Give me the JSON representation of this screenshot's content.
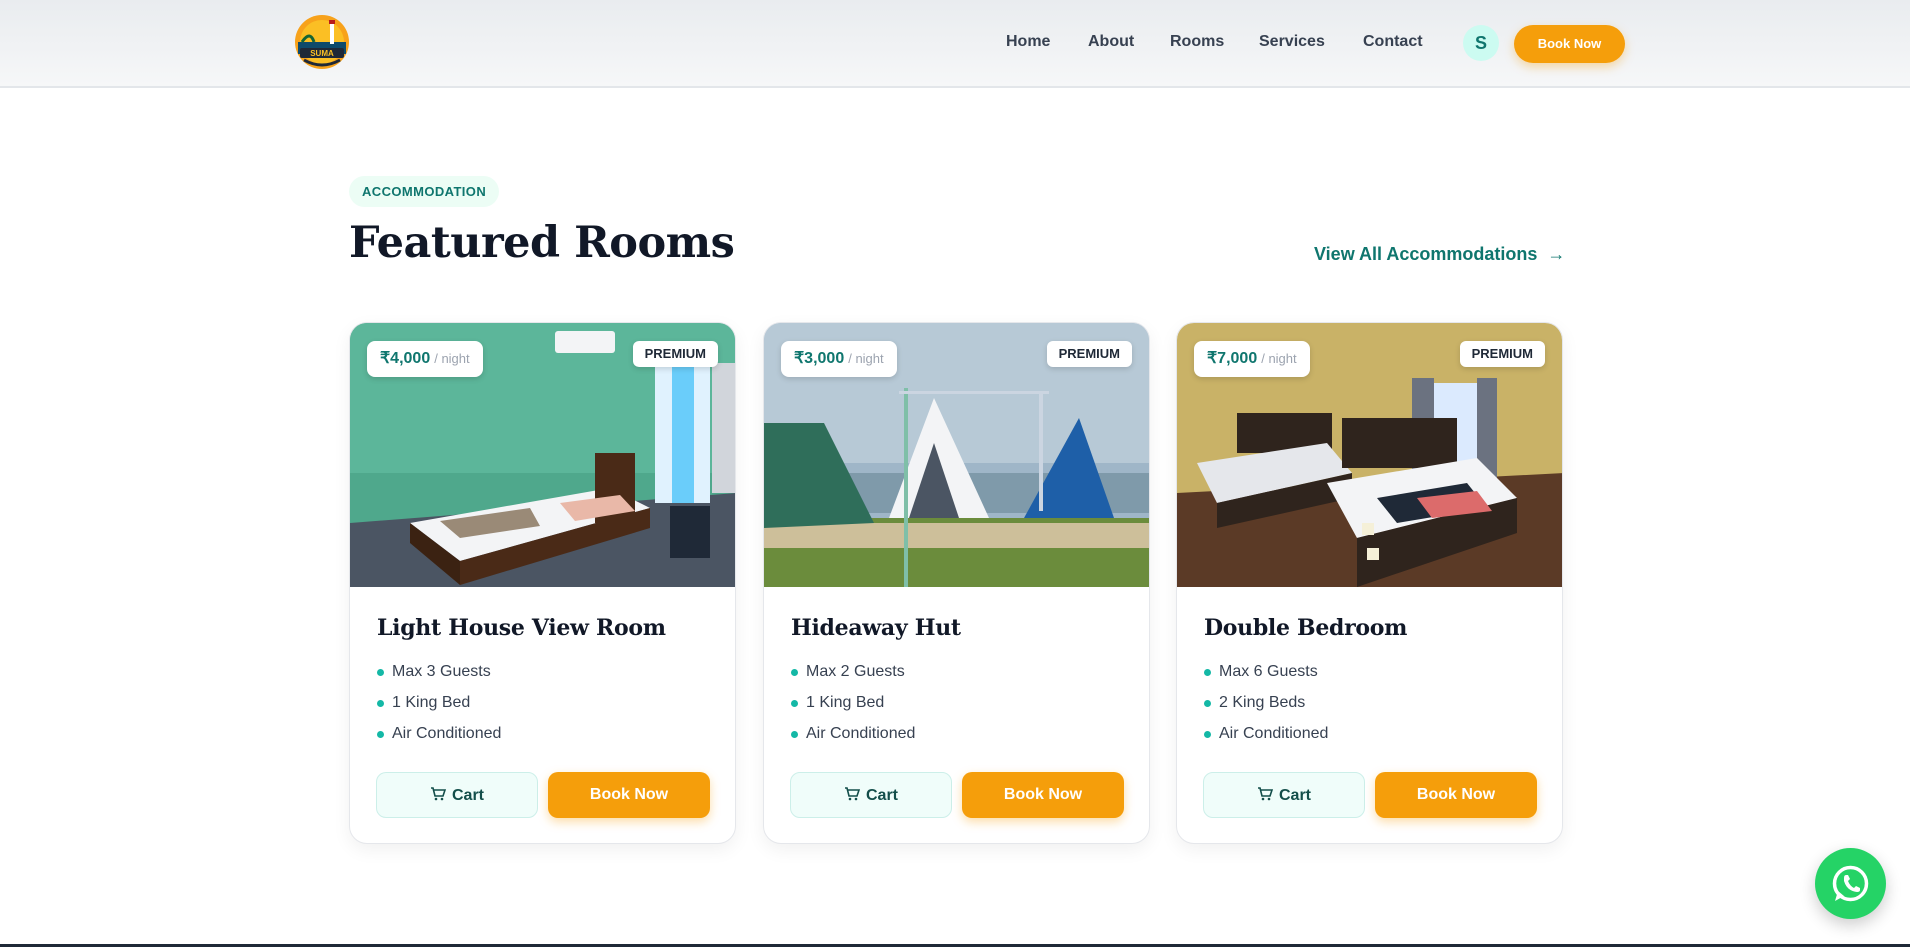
{
  "header": {
    "logo_text": "SUMA",
    "nav": [
      "Home",
      "About",
      "Rooms",
      "Services",
      "Contact"
    ],
    "avatar_initial": "S",
    "book_label": "Book Now"
  },
  "section": {
    "eyebrow": "ACCOMMODATION",
    "title": "Featured Rooms",
    "view_all": "View All Accommodations"
  },
  "rooms": [
    {
      "price": "₹4,000",
      "unit": "/ night",
      "badge": "PREMIUM",
      "name": "Light House View Room",
      "features": [
        "Max 3 Guests",
        "1 King Bed",
        "Air Conditioned"
      ],
      "cart_label": "Cart",
      "book_label": "Book Now"
    },
    {
      "price": "₹3,000",
      "unit": "/ night",
      "badge": "PREMIUM",
      "name": "Hideaway Hut",
      "features": [
        "Max 2 Guests",
        "1 King Bed",
        "Air Conditioned"
      ],
      "cart_label": "Cart",
      "book_label": "Book Now"
    },
    {
      "price": "₹7,000",
      "unit": "/ night",
      "badge": "PREMIUM",
      "name": "Double Bedroom",
      "features": [
        "Max 6 Guests",
        "2 King Beds",
        "Air Conditioned"
      ],
      "cart_label": "Cart",
      "book_label": "Book Now"
    }
  ],
  "colors": {
    "accent": "#f59e0b",
    "teal": "#0f766e",
    "whatsapp": "#25d366"
  }
}
